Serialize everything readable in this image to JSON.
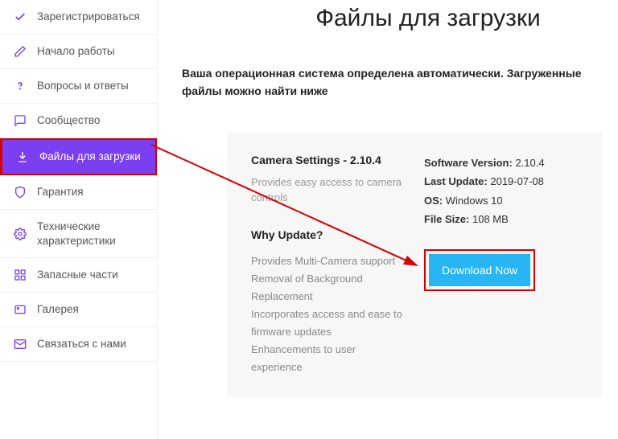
{
  "sidebar": {
    "items": [
      {
        "label": "Зарегистрироваться"
      },
      {
        "label": "Начало работы"
      },
      {
        "label": "Вопросы и ответы"
      },
      {
        "label": "Сообщество"
      },
      {
        "label": "Файлы для загрузки"
      },
      {
        "label": "Гарантия"
      },
      {
        "label": "Технические характеристики"
      },
      {
        "label": "Запасные части"
      },
      {
        "label": "Галерея"
      },
      {
        "label": "Связаться с нами"
      }
    ]
  },
  "main": {
    "title": "Файлы для загрузки",
    "notice": "Ваша операционная система определена автоматически. Загруженные файлы можно найти ниже",
    "card": {
      "title": "Camera Settings - 2.10.4",
      "desc": "Provides easy access to camera controls",
      "why_title": "Why Update?",
      "why_body": "Provides Multi-Camera support Removal of Background Replacement\nIncorporates access and ease to firmware updates\nEnhancements to user experience",
      "specs": {
        "sv_label": "Software Version:",
        "sv": "2.10.4",
        "lu_label": "Last Update:",
        "lu": "2019-07-08",
        "os_label": "OS:",
        "os": "Windows 10",
        "fs_label": "File Size:",
        "fs": "108 MB"
      },
      "download": "Download Now"
    }
  }
}
